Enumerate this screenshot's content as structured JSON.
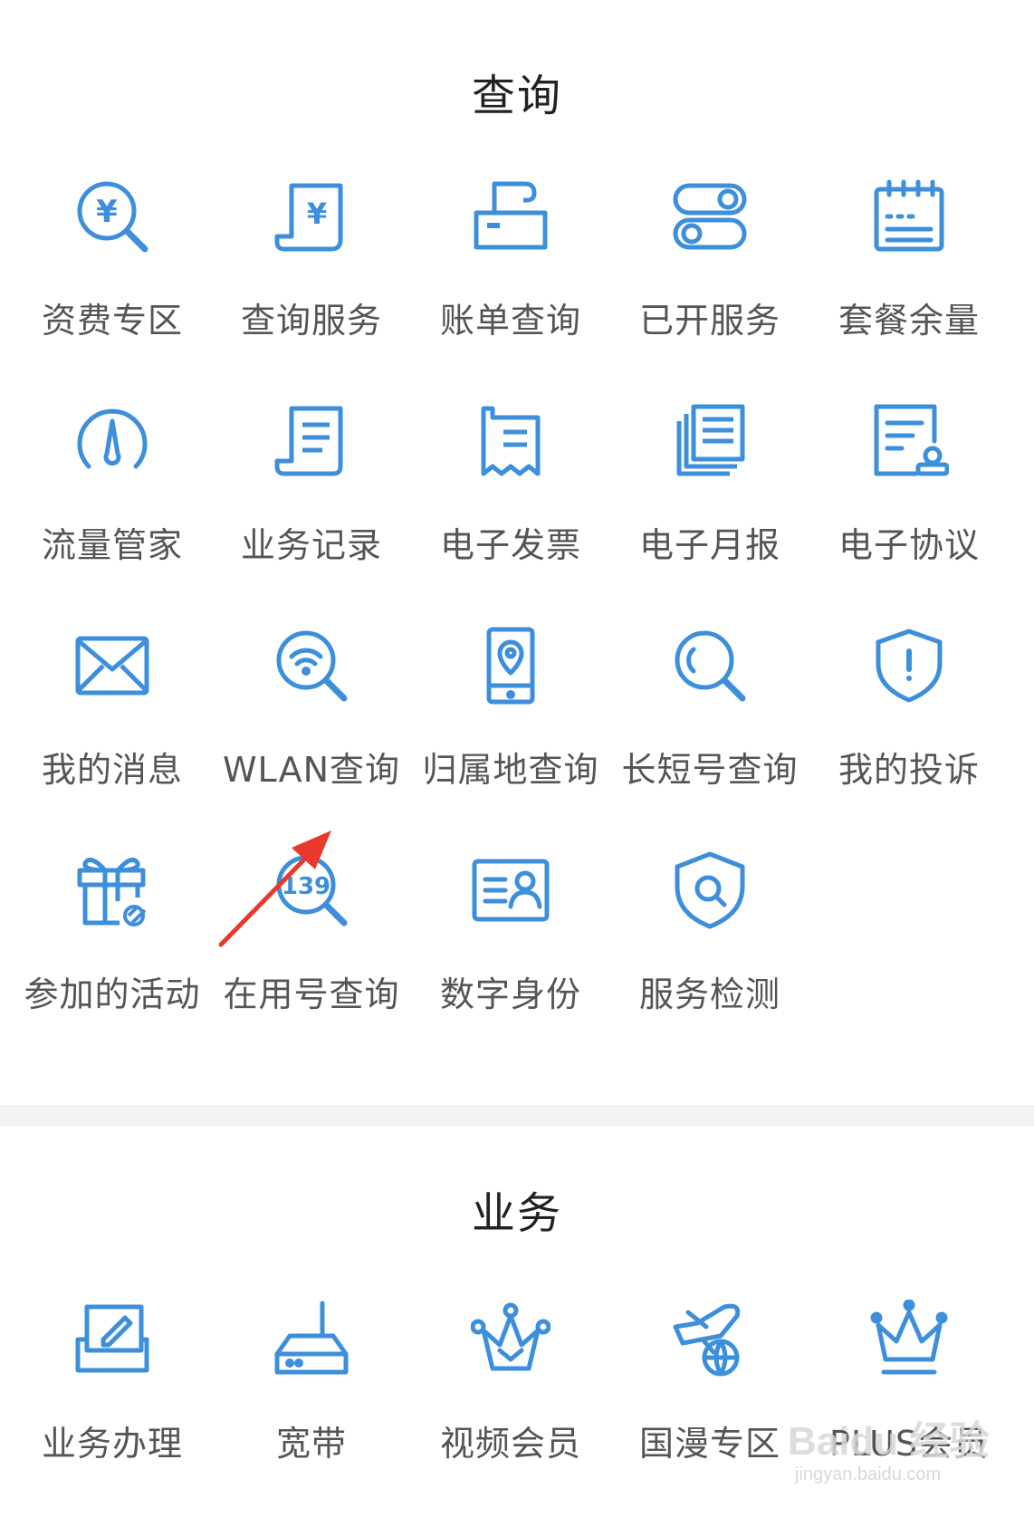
{
  "query_section": {
    "title": "查询",
    "items": [
      {
        "label": "资费专区",
        "icon": "yuan-search-icon"
      },
      {
        "label": "查询服务",
        "icon": "yuan-receipt-icon"
      },
      {
        "label": "账单查询",
        "icon": "printer-icon"
      },
      {
        "label": "已开服务",
        "icon": "toggles-icon"
      },
      {
        "label": "套餐余量",
        "icon": "notepad-icon"
      },
      {
        "label": "流量管家",
        "icon": "gauge-icon"
      },
      {
        "label": "业务记录",
        "icon": "document-list-icon"
      },
      {
        "label": "电子发票",
        "icon": "invoice-icon"
      },
      {
        "label": "电子月报",
        "icon": "report-icon"
      },
      {
        "label": "电子协议",
        "icon": "agreement-icon"
      },
      {
        "label": "我的消息",
        "icon": "mail-icon"
      },
      {
        "label": "WLAN查询",
        "icon": "wifi-search-icon"
      },
      {
        "label": "归属地查询",
        "icon": "phone-location-icon"
      },
      {
        "label": "长短号查询",
        "icon": "search-icon"
      },
      {
        "label": "我的投诉",
        "icon": "shield-alert-icon"
      },
      {
        "label": "参加的活动",
        "icon": "gift-icon"
      },
      {
        "label": "在用号查询",
        "icon": "number-search-icon"
      },
      {
        "label": "数字身份",
        "icon": "id-card-icon"
      },
      {
        "label": "服务检测",
        "icon": "shield-search-icon"
      }
    ]
  },
  "business_section": {
    "title": "业务",
    "items": [
      {
        "label": "业务办理",
        "icon": "edit-tray-icon"
      },
      {
        "label": "宽带",
        "icon": "router-icon"
      },
      {
        "label": "视频会员",
        "icon": "crown-check-icon"
      },
      {
        "label": "国漫专区",
        "icon": "plane-globe-icon"
      },
      {
        "label": "PLUS会员",
        "icon": "crown-icon"
      }
    ]
  },
  "icon_number_text": "139",
  "yuan_symbol": "¥",
  "watermark": {
    "main": "Baidu 经验",
    "sub": "jingyan.baidu.com"
  },
  "colors": {
    "icon_blue": "#3d8fdc",
    "arrow_red": "#e8392c",
    "label_gray": "#555555"
  }
}
